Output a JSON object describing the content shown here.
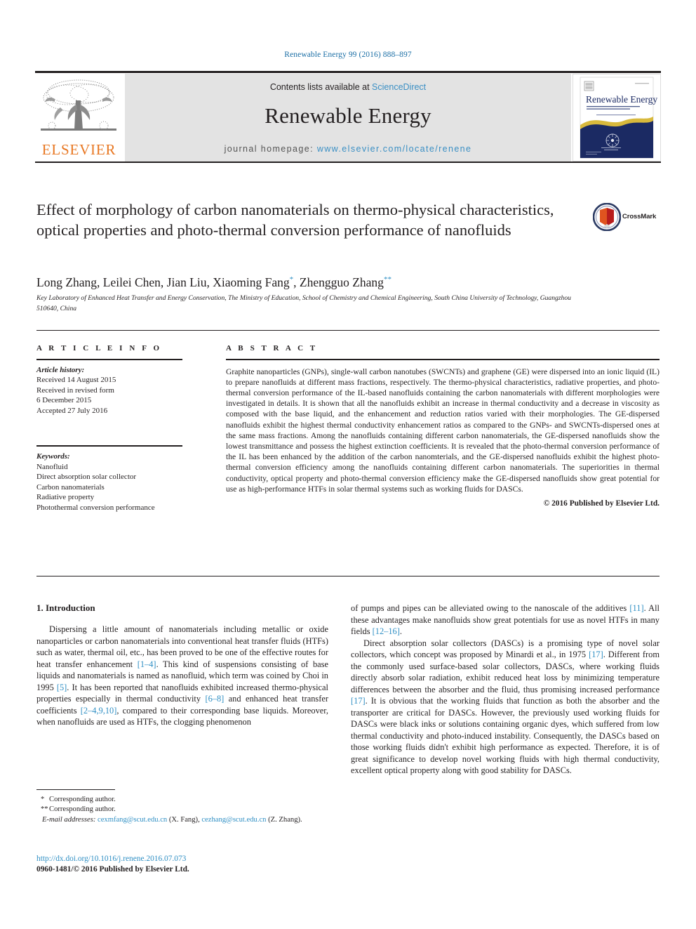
{
  "running_head": "Renewable Energy 99 (2016) 888–897",
  "masthead": {
    "publisher_name": "ELSEVIER",
    "publisher_logo_icon": "elsevier-tree-logo",
    "contents_prefix": "Contents lists available at ",
    "contents_link": "ScienceDirect",
    "journal_name": "Renewable Energy",
    "homepage_prefix": "journal homepage: ",
    "homepage_url": "www.elsevier.com/locate/renene",
    "cover": {
      "title": "Renewable Energy",
      "subtitle": "AN INTERNATIONAL JOURNAL",
      "tagline": "Official Journal of WREN — World Renewable Energy Network",
      "publisher_mark": "ELSEVIER",
      "bg_color": "#1b2a63",
      "wave_color": "#d8b93c"
    }
  },
  "article": {
    "title": "Effect of morphology of carbon nanomaterials on thermo-physical characteristics, optical properties and photo-thermal conversion performance of nanofluids",
    "crossmark_label": "CrossMark",
    "crossmark_icon": "crossmark-badge-icon",
    "authors": "Long Zhang, Leilei Chen, Jian Liu, Xiaoming Fang",
    "author_mark_1": "*",
    "author_last": ", Zhengguo Zhang",
    "author_mark_2": "**",
    "affiliation": "Key Laboratory of Enhanced Heat Transfer and Energy Conservation, The Ministry of Education, School of Chemistry and Chemical Engineering, South China University of Technology, Guangzhou 510640, China"
  },
  "article_info": {
    "heading": "A R T I C L E   I N F O",
    "history_label": "Article history:",
    "history_lines": [
      "Received 14 August 2015",
      "Received in revised form",
      "6 December 2015",
      "Accepted 27 July 2016"
    ],
    "keywords_label": "Keywords:",
    "keywords": [
      "Nanofluid",
      "Direct absorption solar collector",
      "Carbon nanomaterials",
      "Radiative property",
      "Photothermal conversion performance"
    ]
  },
  "abstract": {
    "heading": "A B S T R A C T",
    "text": "Graphite nanoparticles (GNPs), single-wall carbon nanotubes (SWCNTs) and graphene (GE) were dispersed into an ionic liquid (IL) to prepare nanofluids at different mass fractions, respectively. The thermo-physical characteristics, radiative properties, and photo-thermal conversion performance of the IL-based nanofluids containing the carbon nanomaterials with different morphologies were investigated in details. It is shown that all the nanofluids exhibit an increase in thermal conductivity and a decrease in viscosity as composed with the base liquid, and the enhancement and reduction ratios varied with their morphologies. The GE-dispersed nanofluids exhibit the highest thermal conductivity enhancement ratios as compared to the GNPs- and SWCNTs-dispersed ones at the same mass fractions. Among the nanofluids containing different carbon nanomaterials, the GE-dispersed nanofluids show the lowest transmittance and possess the highest extinction coefficients. It is revealed that the photo-thermal conversion performance of the IL has been enhanced by the addition of the carbon nanomterials, and the GE-dispersed nanofluids exhibit the highest photo-thermal conversion efficiency among the nanofluids containing different carbon nanomaterials. The superiorities in thermal conductivity, optical property and photo-thermal conversion efficiency make the GE-dispersed nanofluids show great potential for use as high-performance HTFs in solar thermal systems such as working fluids for DASCs.",
    "copyright": "© 2016 Published by Elsevier Ltd."
  },
  "body": {
    "section_number_title": "1.  Introduction",
    "left_paragraph_1_a": "Dispersing a little amount of nanomaterials including metallic or oxide nanoparticles or carbon nanomaterials into conventional heat transfer fluids (HTFs) such as water, thermal oil, etc., has been proved to be one of the effective routes for heat transfer enhancement ",
    "left_ref_1": "[1–4]",
    "left_paragraph_1_b": ". This kind of suspensions consisting of base liquids and nanomaterials is named as nanofluid, which term was coined by Choi in 1995 ",
    "left_ref_2": "[5]",
    "left_paragraph_1_c": ". It has been reported that nanofluids exhibited increased thermo-physical properties especially in thermal conductivity ",
    "left_ref_3": "[6–8]",
    "left_paragraph_1_d": " and enhanced heat transfer coefficients ",
    "left_ref_4": "[2–4,9,10]",
    "left_paragraph_1_e": ", compared to their corresponding base liquids. Moreover, when nanofluids are used as HTFs, the clogging phenomenon",
    "right_paragraph_1_a": "of pumps and pipes can be alleviated owing to the nanoscale of the additives ",
    "right_ref_1": "[11]",
    "right_paragraph_1_b": ". All these advantages make nanofluids show great potentials for use as novel HTFs in many fields ",
    "right_ref_2": "[12–16]",
    "right_paragraph_1_c": ".",
    "right_paragraph_2_a": "Direct absorption solar collectors (DASCs) is a promising type of novel solar collectors, which concept was proposed by Minardi et al., in 1975 ",
    "right_ref_3": "[17]",
    "right_paragraph_2_b": ". Different from the commonly used surface-based solar collectors, DASCs, where working fluids directly absorb solar radiation, exhibit reduced heat loss by minimizing temperature differences between the absorber and the fluid, thus promising increased performance ",
    "right_ref_4": "[17]",
    "right_paragraph_2_c": ". It is obvious that the working fluids that function as both the absorber and the transporter are critical for DASCs. However, the previously used working fluids for DASCs were black inks or solutions containing organic dyes, which suffered from low thermal conductivity and photo-induced instability. Consequently, the DASCs based on those working fluids didn't exhibit high performance as expected. Therefore, it is of great significance to develop novel working fluids with high thermal conductivity, excellent optical property along with good stability for DASCs."
  },
  "footnotes": {
    "corresponding_1_mark": "*",
    "corresponding_1": "Corresponding author.",
    "corresponding_2_mark": "**",
    "corresponding_2": "Corresponding author.",
    "email_label": "E-mail addresses:",
    "email_1": "cexmfang@scut.edu.cn",
    "email_1_owner": "(X. Fang)",
    "email_2": "cezhang@scut.edu.cn",
    "email_2_owner": "(Z. Zhang)."
  },
  "doi_block": {
    "doi": "http://dx.doi.org/10.1016/j.renene.2016.07.073",
    "issn": "0960-1481/© 2016 Published by Elsevier Ltd."
  },
  "colors": {
    "link_blue": "#2f8fc4",
    "elsevier_orange": "#e87722",
    "masthead_gray": "#e3e3e3",
    "cover_navy": "#1b2a63"
  }
}
